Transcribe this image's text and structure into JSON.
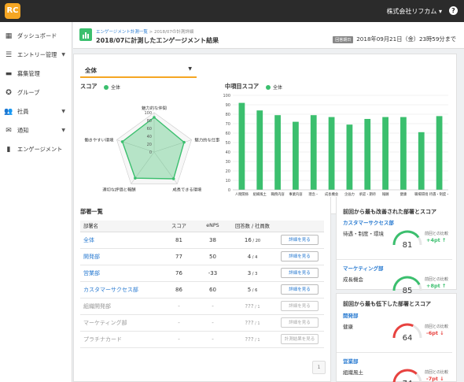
{
  "app": {
    "logo_text": "RC",
    "company": "株式会社リフカム ▾",
    "help": "?"
  },
  "sidebar": {
    "items": [
      {
        "label": "ダッシュボード",
        "icon": "dashboard-icon",
        "glyph": "▦",
        "caret": ""
      },
      {
        "label": "エントリー管理",
        "icon": "list-icon",
        "glyph": "☰",
        "caret": "▼"
      },
      {
        "label": "募集管理",
        "icon": "folder-icon",
        "glyph": "▬",
        "caret": ""
      },
      {
        "label": "グループ",
        "icon": "group-icon",
        "glyph": "✪",
        "caret": ""
      },
      {
        "label": "社員",
        "icon": "people-icon",
        "glyph": "👥",
        "caret": "▼"
      },
      {
        "label": "通知",
        "icon": "mail-icon",
        "glyph": "✉",
        "caret": "▼"
      },
      {
        "label": "エンゲージメント",
        "icon": "chart-icon",
        "glyph": "▮",
        "caret": ""
      }
    ]
  },
  "header": {
    "breadcrumb_link": "エンゲージメント計測一覧",
    "breadcrumb_current": "2018/07の計測詳細",
    "title": "2018/07に計測したエンゲージメント結果",
    "deadline_label": "回答期日",
    "deadline": "2018年09月21日（金）23時59分まで"
  },
  "filter": {
    "selected": "全体",
    "caret": "▼"
  },
  "radar": {
    "title": "スコア",
    "legend": "全体",
    "axes": [
      "魅力的な仲間",
      "魅力的な仕事",
      "成長できる環境",
      "適切な評価と報酬",
      "働きやすい環境"
    ],
    "values": [
      88,
      80,
      84,
      82,
      85
    ],
    "max": 100,
    "ticks": [
      "100",
      "80",
      "60",
      "40",
      "20",
      "0"
    ]
  },
  "chart_data": {
    "type": "bar",
    "title": "中項目スコア",
    "series": [
      {
        "name": "全体",
        "values": [
          92,
          84,
          79,
          72,
          79,
          77,
          69,
          75,
          77,
          77,
          61,
          78
        ]
      }
    ],
    "categories": [
      [
        "人間関係"
      ],
      [
        "組織風土"
      ],
      [
        "職務内容"
      ],
      [
        "事業内容"
      ],
      [
        "理念・",
        "経営陣"
      ],
      [
        "成長機会"
      ],
      [
        "企画力"
      ],
      [
        "承認・期待"
      ],
      [
        "報酬"
      ],
      [
        "健康"
      ],
      [
        "職場環境"
      ],
      [
        "待遇・制度・",
        "環境"
      ]
    ],
    "ylim": [
      0,
      100
    ],
    "yticks": [
      "0",
      "10",
      "20",
      "30",
      "40",
      "50",
      "60",
      "70",
      "80",
      "90",
      "100"
    ],
    "color": "#3bbf6e"
  },
  "dept": {
    "title": "部署一覧",
    "headers": [
      "部署名",
      "スコア",
      "eNPS",
      "回答数 / 社員数",
      ""
    ],
    "rows": [
      {
        "name": "全体",
        "score": "81",
        "enps": "38",
        "ans": "16",
        "emp": "/ 20",
        "btn": "詳細を見る",
        "gray": false
      },
      {
        "name": "開発部",
        "score": "77",
        "enps": "50",
        "ans": "4",
        "emp": "/ 4",
        "btn": "詳細を見る",
        "gray": false
      },
      {
        "name": "営業部",
        "score": "76",
        "enps": "-33",
        "ans": "3",
        "emp": "/ 3",
        "btn": "詳細を見る",
        "gray": false
      },
      {
        "name": "カスタマーサクセス部",
        "score": "86",
        "enps": "60",
        "ans": "5",
        "emp": "/ 6",
        "btn": "詳細を見る",
        "gray": false
      },
      {
        "name": "組織開発部",
        "score": "-",
        "enps": "-",
        "ans": "???",
        "emp": "/ 1",
        "btn": "詳細を見る",
        "gray": true
      },
      {
        "name": "マーケティング部",
        "score": "-",
        "enps": "-",
        "ans": "???",
        "emp": "/ 1",
        "btn": "詳細を見る",
        "gray": true
      },
      {
        "name": "プラチナカード",
        "score": "-",
        "enps": "-",
        "ans": "???",
        "emp": "/ 1",
        "btn": "計測結果を見る",
        "gray": true
      }
    ],
    "page": "1"
  },
  "improved": {
    "title": "前回から最も改善された部署とスコア",
    "cmp_label": "前回との比較",
    "items": [
      {
        "dept": "カスタマーサクセス部",
        "item": "待遇・制度・環境",
        "score": 81,
        "diff": "+4pt ↑"
      },
      {
        "dept": "マーケティング部",
        "item": "成長機会",
        "score": 85,
        "diff": "+8pt ↑"
      }
    ]
  },
  "declined": {
    "title": "前回から最も低下した部署とスコア",
    "cmp_label": "前回との比較",
    "items": [
      {
        "dept": "開発部",
        "item": "健康",
        "score": 64,
        "diff": "-6pt ↓"
      },
      {
        "dept": "営業部",
        "item": "組織風土",
        "score": 74,
        "diff": "-7pt ↓"
      }
    ]
  },
  "colors": {
    "accent": "#f5a623",
    "good": "#3bbf6e",
    "bad": "#e8423f",
    "link": "#2a7bd1"
  }
}
